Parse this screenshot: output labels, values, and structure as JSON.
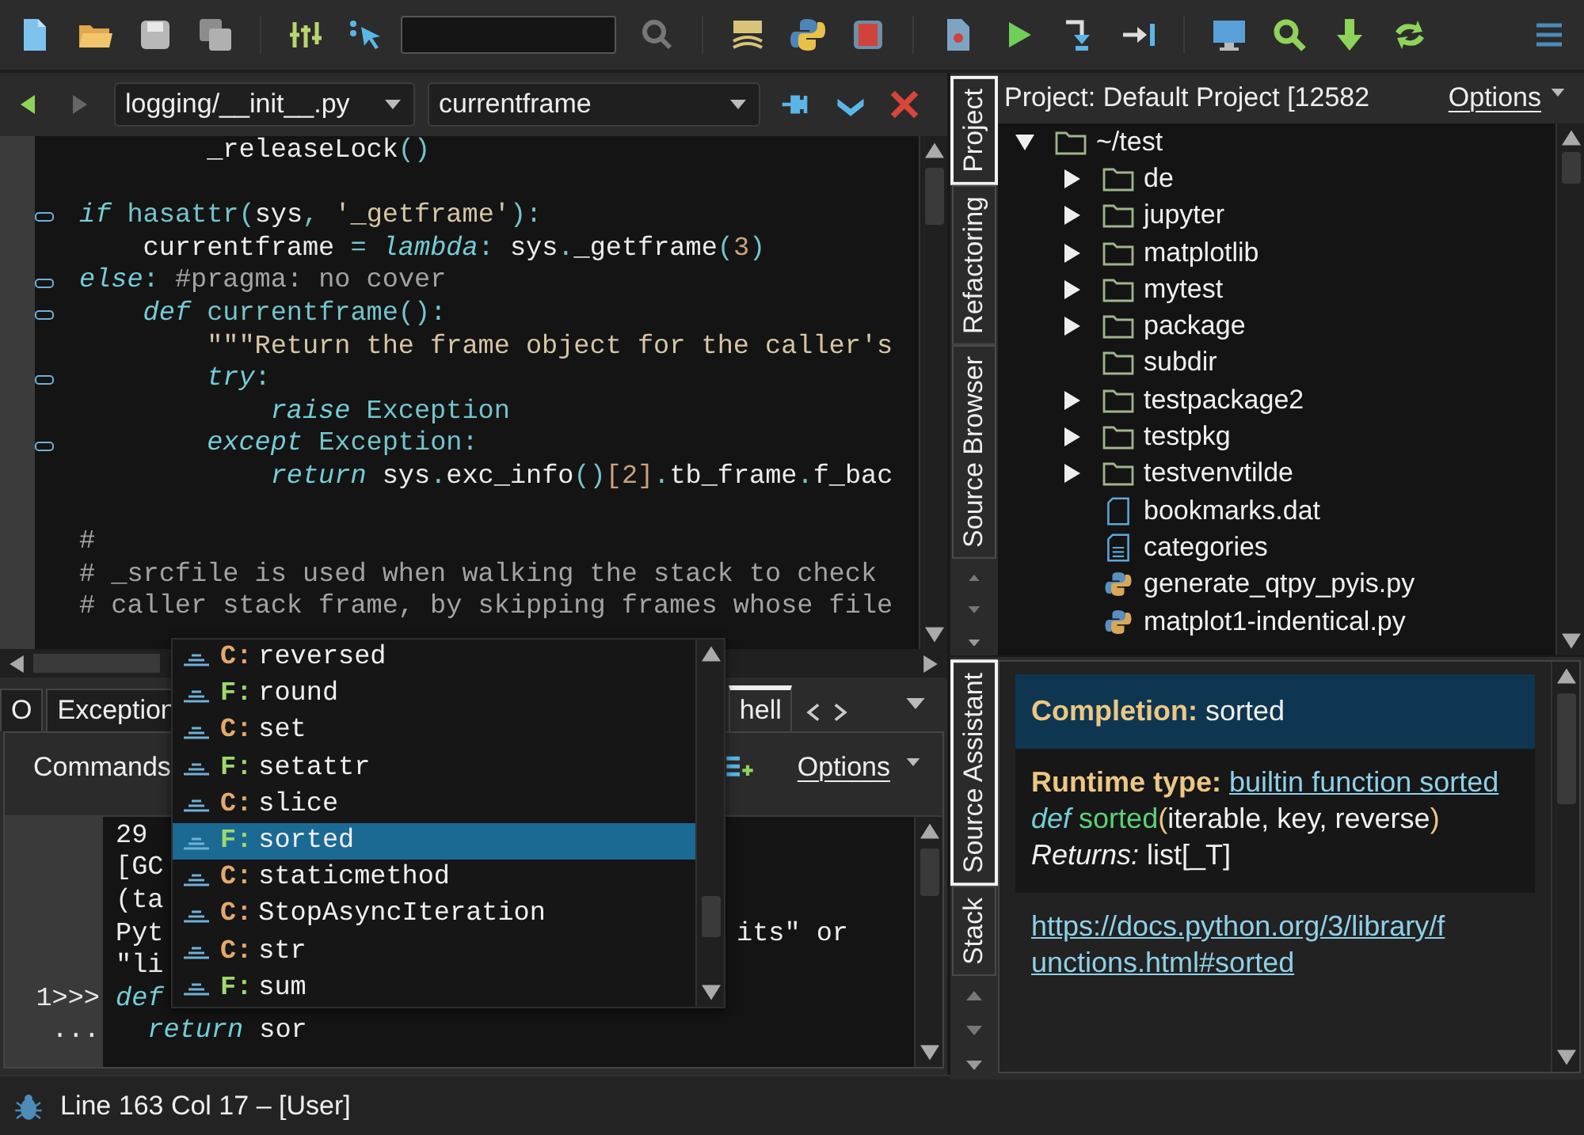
{
  "editor": {
    "back_disabled": false,
    "forward_disabled": true,
    "file": "logging/__init__.py",
    "symbol": "currentframe",
    "lines": [
      {
        "kind": "code",
        "fold": false,
        "tokens": [
          {
            "text": "        _releaseLock",
            "kind": "name"
          },
          {
            "text": "()",
            "kind": "punct"
          }
        ]
      },
      {
        "kind": "blank"
      },
      {
        "kind": "code",
        "fold": true,
        "tokens": [
          {
            "text": "if",
            "kind": "keyword"
          },
          {
            "text": " hasattr",
            "kind": "builtin"
          },
          {
            "text": "(",
            "kind": "punct"
          },
          {
            "text": "sys",
            "kind": "name"
          },
          {
            "text": ", ",
            "kind": "punct"
          },
          {
            "text": "'_getframe'",
            "kind": "string"
          },
          {
            "text": "):",
            "kind": "punct"
          }
        ]
      },
      {
        "kind": "code",
        "fold": false,
        "tokens": [
          {
            "text": "    currentframe ",
            "kind": "name"
          },
          {
            "text": "= ",
            "kind": "punct"
          },
          {
            "text": "lambda",
            "kind": "keyword"
          },
          {
            "text": ": ",
            "kind": "punct"
          },
          {
            "text": "sys",
            "kind": "name"
          },
          {
            "text": ".",
            "kind": "punct"
          },
          {
            "text": "_getframe",
            "kind": "name"
          },
          {
            "text": "(",
            "kind": "punct"
          },
          {
            "text": "3",
            "kind": "number"
          },
          {
            "text": ")",
            "kind": "punct"
          }
        ]
      },
      {
        "kind": "code",
        "fold": true,
        "tokens": [
          {
            "text": "else",
            "kind": "keyword"
          },
          {
            "text": ": ",
            "kind": "punct"
          },
          {
            "text": "#pragma: no cover",
            "kind": "comment"
          }
        ]
      },
      {
        "kind": "code",
        "fold": true,
        "tokens": [
          {
            "text": "    def",
            "kind": "keyword"
          },
          {
            "text": " currentframe",
            "kind": "builtin"
          },
          {
            "text": "():",
            "kind": "punct"
          }
        ]
      },
      {
        "kind": "code",
        "fold": false,
        "tokens": [
          {
            "text": "        \"\"\"Return the frame object for the caller's",
            "kind": "string"
          }
        ]
      },
      {
        "kind": "code",
        "fold": true,
        "tokens": [
          {
            "text": "        try",
            "kind": "keyword"
          },
          {
            "text": ":",
            "kind": "punct"
          }
        ]
      },
      {
        "kind": "code",
        "fold": false,
        "tokens": [
          {
            "text": "            raise",
            "kind": "keyword"
          },
          {
            "text": " Exception",
            "kind": "builtin"
          }
        ]
      },
      {
        "kind": "code",
        "fold": true,
        "tokens": [
          {
            "text": "        except",
            "kind": "keyword"
          },
          {
            "text": " Exception:",
            "kind": "builtin"
          }
        ]
      },
      {
        "kind": "code",
        "fold": false,
        "tokens": [
          {
            "text": "            return",
            "kind": "keyword"
          },
          {
            "text": " sys",
            "kind": "name"
          },
          {
            "text": ".",
            "kind": "punct"
          },
          {
            "text": "exc_info",
            "kind": "name"
          },
          {
            "text": "()",
            "kind": "punct"
          },
          {
            "text": "[2]",
            "kind": "number"
          },
          {
            "text": ".",
            "kind": "punct"
          },
          {
            "text": "tb_frame",
            "kind": "name"
          },
          {
            "text": ".",
            "kind": "punct"
          },
          {
            "text": "f_bac",
            "kind": "name"
          }
        ]
      },
      {
        "kind": "blank"
      },
      {
        "kind": "code",
        "fold": false,
        "tokens": [
          {
            "text": "#",
            "kind": "comment"
          }
        ]
      },
      {
        "kind": "code",
        "fold": false,
        "tokens": [
          {
            "text": "# _srcfile is used when walking the stack to check",
            "kind": "comment"
          }
        ]
      },
      {
        "kind": "code",
        "fold": false,
        "tokens": [
          {
            "text": "# caller stack frame, by skipping frames whose file",
            "kind": "comment"
          }
        ]
      }
    ]
  },
  "completion_popup": {
    "items": [
      {
        "kind": "class",
        "prefix": "C:",
        "name": "reversed",
        "selected": false
      },
      {
        "kind": "function",
        "prefix": "F:",
        "name": "round",
        "selected": false
      },
      {
        "kind": "class",
        "prefix": "C:",
        "name": "set",
        "selected": false
      },
      {
        "kind": "function",
        "prefix": "F:",
        "name": "setattr",
        "selected": false
      },
      {
        "kind": "class",
        "prefix": "C:",
        "name": "slice",
        "selected": false
      },
      {
        "kind": "function",
        "prefix": "F:",
        "name": "sorted",
        "selected": true
      },
      {
        "kind": "class",
        "prefix": "C:",
        "name": "staticmethod",
        "selected": false
      },
      {
        "kind": "class",
        "prefix": "C:",
        "name": "StopAsyncIteration",
        "selected": false
      },
      {
        "kind": "class",
        "prefix": "C:",
        "name": "str",
        "selected": false
      },
      {
        "kind": "function",
        "prefix": "F:",
        "name": "sum",
        "selected": false
      }
    ]
  },
  "bottom_panel": {
    "tabs": [
      {
        "label": "O",
        "selected": false
      },
      {
        "label": "Exception",
        "selected": false
      },
      {
        "label": "hell",
        "selected": true
      }
    ],
    "commands_label": "Commands",
    "options_label": "Options",
    "shell": [
      {
        "tokens": [
          {
            "text": "29",
            "kind": "name"
          }
        ]
      },
      {
        "tokens": [
          {
            "text": "[GC",
            "kind": "name"
          }
        ]
      },
      {
        "tokens": [
          {
            "text": "(ta",
            "kind": "name"
          }
        ]
      },
      {
        "tokens": [
          {
            "text": "Pyt",
            "kind": "name"
          }
        ],
        "right": "its\" or"
      },
      {
        "tokens": [
          {
            "text": "\"li",
            "kind": "name"
          }
        ]
      },
      {
        "prompt": "1>>>",
        "tokens": [
          {
            "text": "def",
            "kind": "keyword"
          }
        ]
      },
      {
        "prompt": "...",
        "tokens": [
          {
            "text": "  return",
            "kind": "keyword"
          },
          {
            "text": " sor",
            "kind": "name"
          }
        ]
      }
    ]
  },
  "side_tabs_top": [
    {
      "label": "Project",
      "selected": true
    },
    {
      "label": "Refactoring",
      "selected": false
    },
    {
      "label": "Source Browser",
      "selected": false
    }
  ],
  "project": {
    "title": "Project: Default Project [12582",
    "options_label": "Options",
    "tree": [
      {
        "name": "~/test",
        "kind": "folder",
        "expanded": true,
        "children": [
          {
            "name": "de",
            "kind": "folder",
            "expanded": false
          },
          {
            "name": "jupyter",
            "kind": "folder",
            "expanded": false
          },
          {
            "name": "matplotlib",
            "kind": "folder",
            "expanded": false
          },
          {
            "name": "mytest",
            "kind": "folder",
            "expanded": false
          },
          {
            "name": "package",
            "kind": "folder",
            "expanded": false
          },
          {
            "name": "subdir",
            "kind": "folder"
          },
          {
            "name": "testpackage2",
            "kind": "folder",
            "expanded": false
          },
          {
            "name": "testpkg",
            "kind": "folder",
            "expanded": false
          },
          {
            "name": "testvenvtilde",
            "kind": "folder",
            "expanded": false
          },
          {
            "name": "bookmarks.dat",
            "kind": "file"
          },
          {
            "name": "categories",
            "kind": "text"
          },
          {
            "name": "generate_qtpy_pyis.py",
            "kind": "python"
          },
          {
            "name": "matplot1-indentical.py",
            "kind": "python"
          }
        ]
      }
    ]
  },
  "side_tabs_bottom": [
    {
      "label": "Source Assistant",
      "selected": true
    },
    {
      "label": "Stack",
      "selected": false
    }
  ],
  "assistant": {
    "completion": {
      "label": "Completion:",
      "value": "sorted"
    },
    "runtime": {
      "label": "Runtime type:",
      "link": "builtin function sorted"
    },
    "signature": {
      "keyword": "def",
      "name": "sorted",
      "open": "(",
      "params": "iterable, key, reverse",
      "close": ")"
    },
    "returns": {
      "label": "Returns:",
      "value": "list[_T]"
    },
    "url": "https://docs.python.org/3/library/functions.html#sorted"
  },
  "status_bar": {
    "text": "Line 163 Col 17 – [User]"
  }
}
